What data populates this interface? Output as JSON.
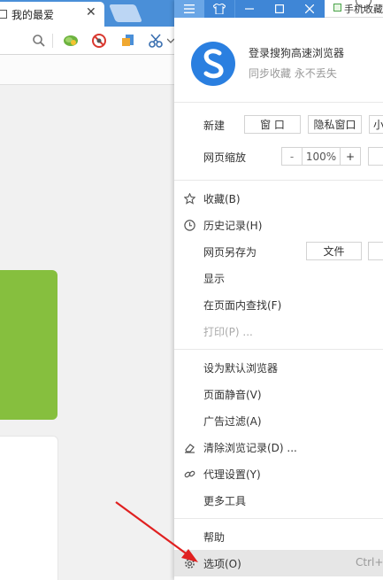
{
  "browser": {
    "tab": {
      "title": "我的最爱",
      "close": "✕"
    },
    "toolbar_icons": [
      "search-icon",
      "lettuce-icon",
      "ad-block-icon",
      "screenshot-icon",
      "scissors-icon",
      "chevron-down-icon"
    ]
  },
  "window_controls": [
    "menu-icon",
    "skin-icon",
    "minimize-icon",
    "maximize-icon",
    "close-icon"
  ],
  "outside": {
    "text": "手机收藏夹"
  },
  "menu": {
    "login_title": "登录搜狗高速浏览器",
    "login_subtitle": "同步收藏 永不丢失",
    "new_label": "新建",
    "new_window": "窗 口",
    "new_private": "隐私窗口",
    "new_small": "小",
    "zoom_label": "网页缩放",
    "zoom_minus": "-",
    "zoom_value": "100%",
    "zoom_plus": "+",
    "favorites": "收藏(B)",
    "history": "历史记录(H)",
    "save_as_label": "网页另存为",
    "save_as_file": "文件",
    "show": "显示",
    "find": "在页面内查找(F)",
    "print": "打印(P) ...",
    "set_default": "设为默认浏览器",
    "mute": "页面静音(V)",
    "ad_filter": "广告过滤(A)",
    "clear_history": "清除浏览记录(D) ...",
    "proxy": "代理设置(Y)",
    "more_tools": "更多工具",
    "help": "帮助",
    "options": "选项(O)",
    "options_shortcut": "Ctrl+"
  },
  "colors": {
    "titlebar": "#3f86d6",
    "green_card": "#86bf3e",
    "arrow": "#e02020",
    "highlight": "#e6e6e6"
  }
}
